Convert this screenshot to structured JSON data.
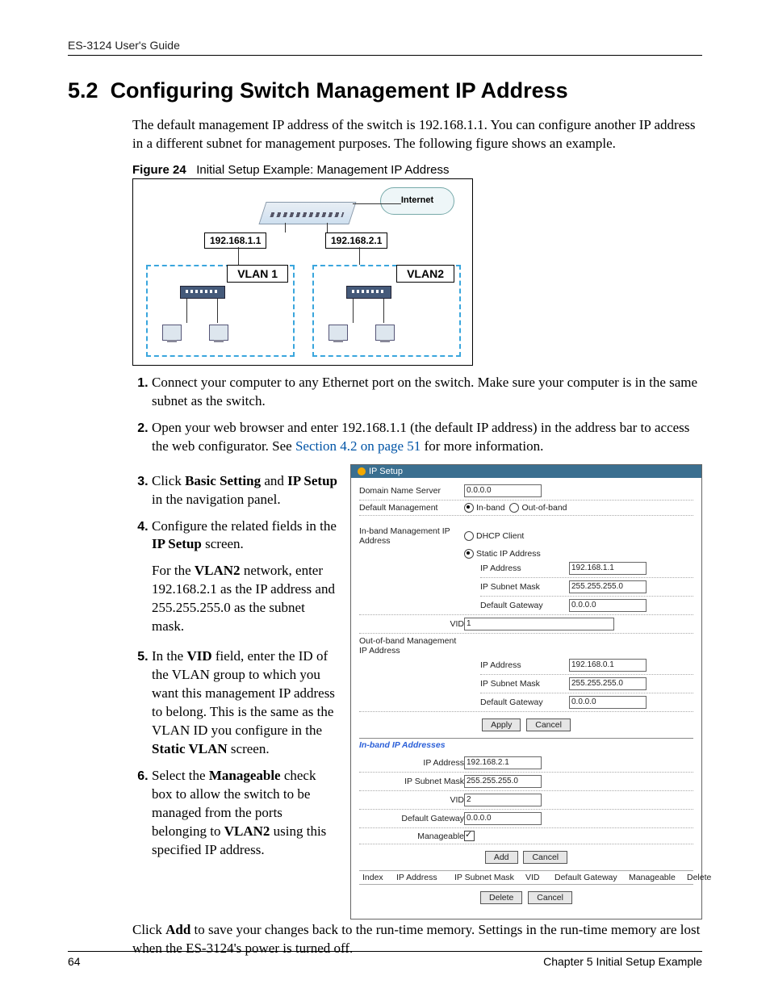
{
  "header": {
    "running": "ES-3124 User's Guide"
  },
  "section": {
    "number": "5.2",
    "title": "Configuring Switch Management IP Address",
    "intro": "The default management IP address of the switch is 192.168.1.1. You can configure another IP address in a different subnet for management purposes. The following figure shows an example."
  },
  "figure24": {
    "caption_label": "Figure 24",
    "caption_text": "Initial Setup Example: Management IP Address",
    "internet": "Internet",
    "ip1": "192.168.1.1",
    "ip2": "192.168.2.1",
    "vlan1": "VLAN 1",
    "vlan2": "VLAN2"
  },
  "steps": {
    "s1": "Connect your computer to any Ethernet port on the switch. Make sure your computer is in the same subnet as the switch.",
    "s2_a": "Open your web browser and enter 192.168.1.1 (the default IP address) in the address bar to access the web configurator. See ",
    "s2_link": "Section 4.2 on page 51",
    "s2_b": " for more information.",
    "s3_a": "Click ",
    "s3_b1": "Basic Setting",
    "s3_mid": " and ",
    "s3_b2": "IP Setup",
    "s3_c": " in the navigation panel.",
    "s4_a": "Configure the related fields in the ",
    "s4_b": "IP Setup",
    "s4_c": " screen.",
    "s4_sub_a": "For the ",
    "s4_sub_b": "VLAN2",
    "s4_sub_c": " network, enter 192.168.2.1 as the IP address and 255.255.255.0 as the subnet mask.",
    "s5_a": "In the ",
    "s5_b": "VID",
    "s5_c": " field, enter the ID of the VLAN group to which you want this management IP address to belong.  This is the same as the VLAN ID you configure in the ",
    "s5_d": "Static VLAN",
    "s5_e": " screen.",
    "s6_a": "Select the ",
    "s6_b": "Manageable",
    "s6_c": " check box to allow the switch to be managed from the ports belonging to ",
    "s6_d": "VLAN2",
    "s6_e": " using this specified IP address.",
    "after_a": "Click ",
    "after_b": "Add",
    "after_c": " to save your changes back to the run-time memory. Settings in the run-time memory are lost when the ES-3124's power is turned off."
  },
  "ipsetup": {
    "title": "IP Setup",
    "labels": {
      "dns": "Domain Name Server",
      "defmgmt": "Default Management",
      "inband": "In-band",
      "outband": "Out-of-band",
      "inband_hdr": "In-band Management IP Address",
      "dhcp": "DHCP Client",
      "static": "Static IP Address",
      "ipaddr": "IP Address",
      "mask": "IP Subnet Mask",
      "gw": "Default Gateway",
      "vid": "VID",
      "outband_hdr": "Out-of-band Management IP Address",
      "apply": "Apply",
      "cancel": "Cancel",
      "section2": "In-band IP Addresses",
      "manageable": "Manageable",
      "add": "Add",
      "delete": "Delete",
      "th_index": "Index",
      "th_ip": "IP Address",
      "th_mask": "IP Subnet Mask",
      "th_vid": "VID",
      "th_gw": "Default Gateway",
      "th_man": "Manageable",
      "th_del": "Delete"
    },
    "values": {
      "dns": "0.0.0.0",
      "in_ip": "192.168.1.1",
      "in_mask": "255.255.255.0",
      "in_gw": "0.0.0.0",
      "in_vid": "1",
      "ob_ip": "192.168.0.1",
      "ob_mask": "255.255.255.0",
      "ob_gw": "0.0.0.0",
      "add_ip": "192.168.2.1",
      "add_mask": "255.255.255.0",
      "add_vid": "2",
      "add_gw": "0.0.0.0"
    }
  },
  "footer": {
    "page": "64",
    "chapter": "Chapter 5 Initial Setup Example"
  }
}
